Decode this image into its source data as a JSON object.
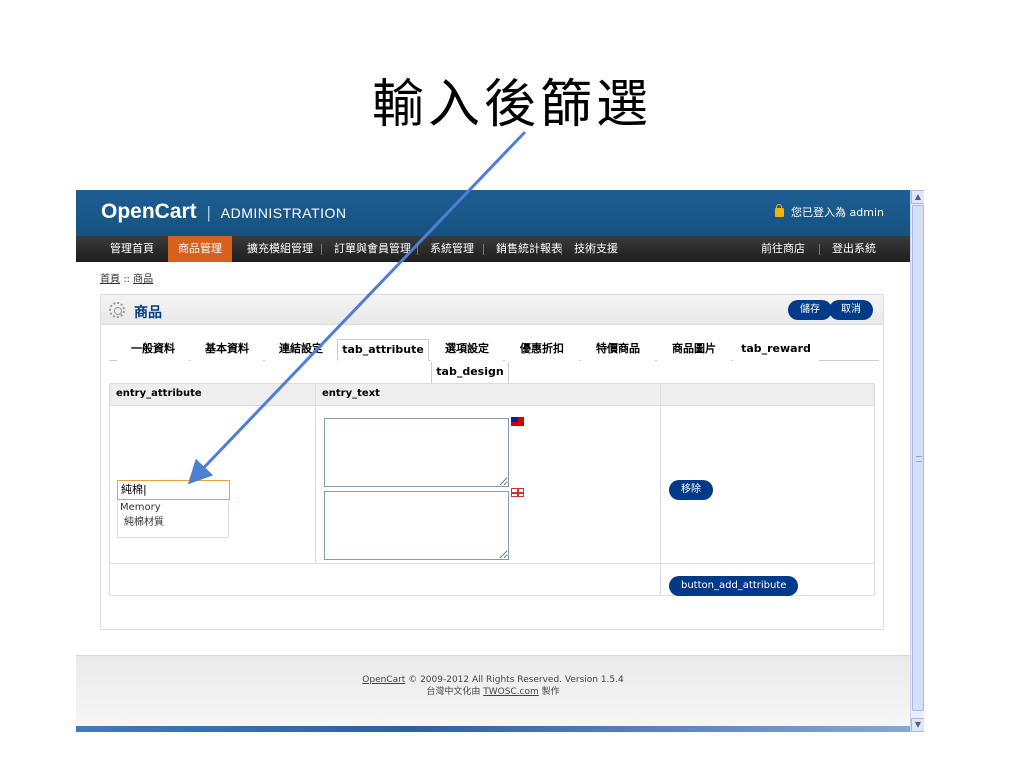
{
  "annotation": {
    "title": "輸入後篩選",
    "arrow_color": "#4f7fd3"
  },
  "header": {
    "logo_main": "OpenCart",
    "logo_sep": "|",
    "logo_sub": "ADMINISTRATION",
    "login_text": "您已登入為 admin"
  },
  "menu": {
    "items": [
      "管理首頁",
      "商品管理",
      "擴充模組管理",
      "訂單與會員管理",
      "系統管理",
      "銷售統計報表",
      "技術支援"
    ],
    "active": "商品管理",
    "right_items": [
      "前往商店",
      "登出系統"
    ]
  },
  "breadcrumb": {
    "home": "首頁",
    "sep": "::",
    "current": "商品"
  },
  "panel": {
    "title": "商品",
    "save": "儲存",
    "cancel": "取消"
  },
  "tabs": [
    "一般資料",
    "基本資料",
    "連結設定",
    "tab_attribute",
    "選項設定",
    "優惠折扣",
    "特價商品",
    "商品圖片",
    "tab_reward",
    "tab_design"
  ],
  "active_tab": "tab_attribute",
  "attribute_table": {
    "headers": [
      "entry_attribute",
      "entry_text",
      ""
    ],
    "input_value": "純棉|",
    "autocomplete": [
      "Memory",
      "純棉材質"
    ],
    "remove_button": "移除",
    "add_button": "button_add_attribute"
  },
  "footer": {
    "line1_link": "OpenCart",
    "line1_text": "© 2009-2012 All Rights Reserved. Version 1.5.4",
    "line2_text": "台灣中文化由",
    "line2_link": "TWOSC.com",
    "line2_suffix": "製作"
  },
  "colors": {
    "header_blue": "#1d5e93",
    "active_menu": "#d8601d",
    "button_blue": "#003a88",
    "input_focus": "#e9a23b"
  }
}
